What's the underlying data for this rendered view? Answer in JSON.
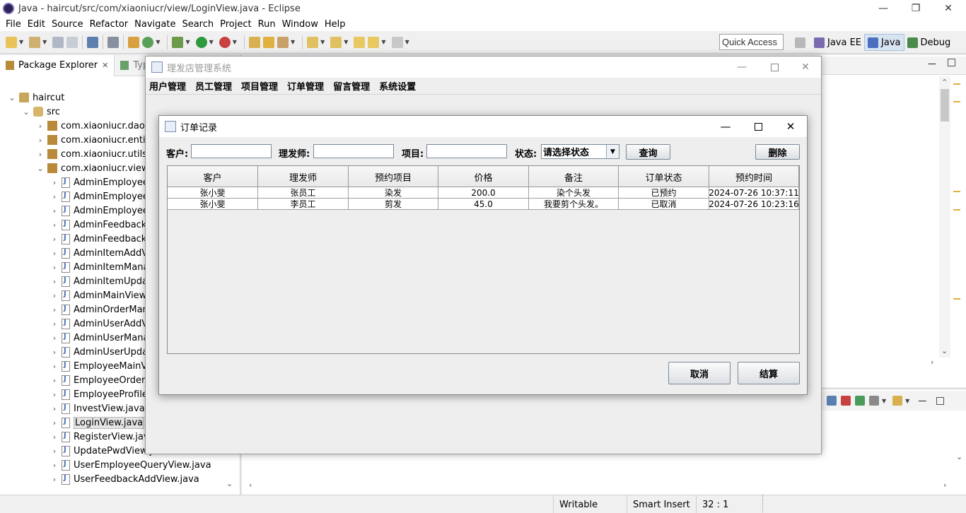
{
  "eclipse": {
    "window_title": "Java - haircut/src/com/xiaoniucr/view/LoginView.java - Eclipse",
    "menu": [
      "File",
      "Edit",
      "Source",
      "Refactor",
      "Navigate",
      "Search",
      "Project",
      "Run",
      "Window",
      "Help"
    ],
    "quick_access": "Quick Access",
    "perspectives": [
      {
        "label": "Java EE",
        "color": "#7a6ab0"
      },
      {
        "label": "Java",
        "color": "#4a6fbf"
      },
      {
        "label": "Debug",
        "color": "#4a8a4a"
      }
    ],
    "package_explorer": {
      "tab_label": "Package Explorer",
      "other_tab": "Type",
      "tree": [
        {
          "label": "haircut",
          "level": 0,
          "arrow": "⌄",
          "icon": "project"
        },
        {
          "label": "src",
          "level": 1,
          "arrow": "⌄",
          "icon": "src"
        },
        {
          "label": "com.xiaoniucr.dao",
          "level": 2,
          "arrow": "›",
          "icon": "pkg"
        },
        {
          "label": "com.xiaoniucr.entity",
          "level": 2,
          "arrow": "›",
          "icon": "pkg"
        },
        {
          "label": "com.xiaoniucr.utils",
          "level": 2,
          "arrow": "›",
          "icon": "pkg"
        },
        {
          "label": "com.xiaoniucr.view",
          "level": 2,
          "arrow": "⌄",
          "icon": "pkg"
        },
        {
          "label": "AdminEmployeeA",
          "level": 3,
          "arrow": "›",
          "icon": "java"
        },
        {
          "label": "AdminEmployeeM",
          "level": 3,
          "arrow": "›",
          "icon": "java"
        },
        {
          "label": "AdminEmployeeU",
          "level": 3,
          "arrow": "›",
          "icon": "java"
        },
        {
          "label": "AdminFeedbackM",
          "level": 3,
          "arrow": "›",
          "icon": "java"
        },
        {
          "label": "AdminFeedbackR",
          "level": 3,
          "arrow": "›",
          "icon": "java"
        },
        {
          "label": "AdminItemAddVi",
          "level": 3,
          "arrow": "›",
          "icon": "java"
        },
        {
          "label": "AdminItemManag",
          "level": 3,
          "arrow": "›",
          "icon": "java"
        },
        {
          "label": "AdminItemUpdat",
          "level": 3,
          "arrow": "›",
          "icon": "java"
        },
        {
          "label": "AdminMainView.j",
          "level": 3,
          "arrow": "›",
          "icon": "java"
        },
        {
          "label": "AdminOrderMana",
          "level": 3,
          "arrow": "›",
          "icon": "java"
        },
        {
          "label": "AdminUserAddVi",
          "level": 3,
          "arrow": "›",
          "icon": "java"
        },
        {
          "label": "AdminUserManag",
          "level": 3,
          "arrow": "›",
          "icon": "java"
        },
        {
          "label": "AdminUserUpdat",
          "level": 3,
          "arrow": "›",
          "icon": "java"
        },
        {
          "label": "EmployeeMainVie",
          "level": 3,
          "arrow": "›",
          "icon": "java"
        },
        {
          "label": "EmployeeOrderM",
          "level": 3,
          "arrow": "›",
          "icon": "java"
        },
        {
          "label": "EmployeeProfileV",
          "level": 3,
          "arrow": "›",
          "icon": "java"
        },
        {
          "label": "InvestView.java",
          "level": 3,
          "arrow": "›",
          "icon": "java"
        },
        {
          "label": "LoginView.java",
          "level": 3,
          "arrow": "›",
          "icon": "java",
          "selected": true
        },
        {
          "label": "RegisterView.java",
          "level": 3,
          "arrow": "›",
          "icon": "java"
        },
        {
          "label": "UpdatePwdView.java",
          "level": 3,
          "arrow": "›",
          "icon": "java"
        },
        {
          "label": "UserEmployeeQueryView.java",
          "level": 3,
          "arrow": "›",
          "icon": "java"
        },
        {
          "label": "UserFeedbackAddView.java",
          "level": 3,
          "arrow": "›",
          "icon": "java"
        }
      ]
    },
    "status_bar": {
      "writable": "Writable",
      "insert_mode": "Smart Insert",
      "position": "32 : 1"
    }
  },
  "app": {
    "title": "理发店管理系统",
    "menu": [
      "用户管理",
      "员工管理",
      "项目管理",
      "订单管理",
      "留言管理",
      "系统设置"
    ]
  },
  "dialog": {
    "title": "订单记录",
    "filters": {
      "customer_label": "客户:",
      "customer_value": "",
      "barber_label": "理发师:",
      "barber_value": "",
      "item_label": "项目:",
      "item_value": "",
      "status_label": "状态:",
      "status_value": "请选择状态"
    },
    "buttons": {
      "query": "查询",
      "delete": "删除",
      "cancel": "取消",
      "settle": "结算"
    },
    "table": {
      "columns": [
        "客户",
        "理发师",
        "预约项目",
        "价格",
        "备注",
        "订单状态",
        "预约时间"
      ],
      "rows": [
        [
          "张小斐",
          "张员工",
          "染发",
          "200.0",
          "染个头发",
          "已预约",
          "2024-07-26 10:37:11"
        ],
        [
          "张小斐",
          "李员工",
          "剪发",
          "45.0",
          "我要剪个头发。",
          "已取消",
          "2024-07-26 10:23:16"
        ]
      ]
    }
  }
}
